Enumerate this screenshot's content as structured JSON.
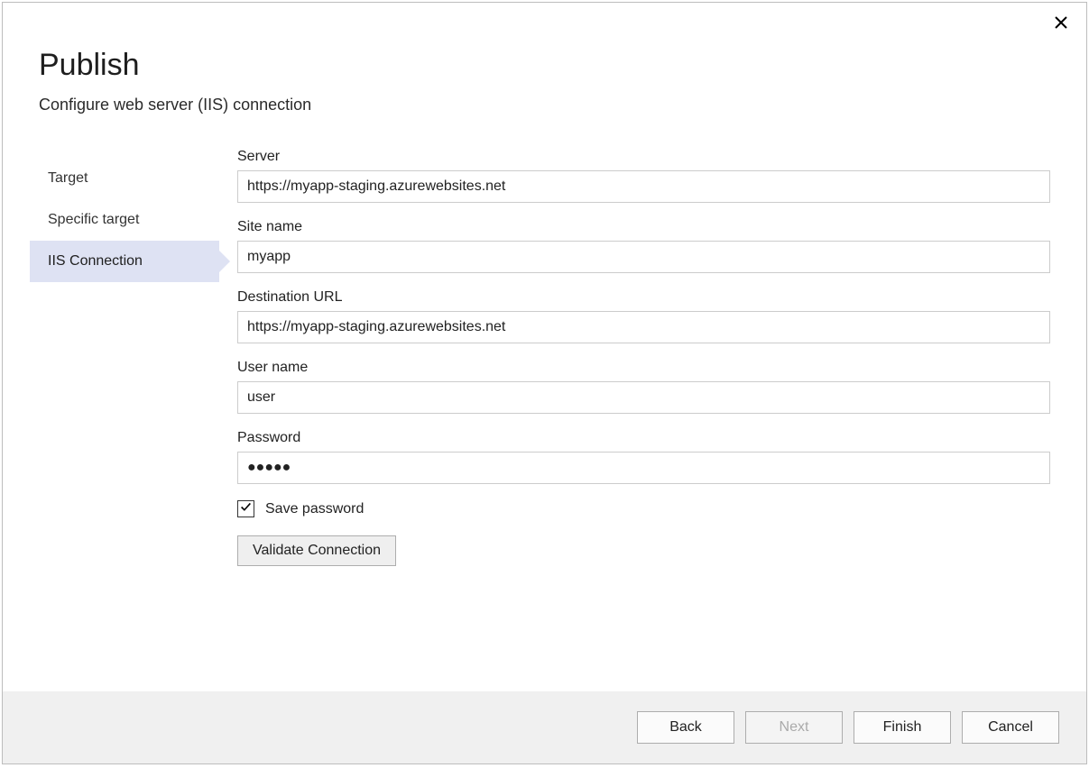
{
  "dialog": {
    "title": "Publish",
    "subtitle": "Configure web server (IIS) connection"
  },
  "sidebar": {
    "items": [
      {
        "label": "Target",
        "active": false
      },
      {
        "label": "Specific target",
        "active": false
      },
      {
        "label": "IIS Connection",
        "active": true
      }
    ]
  },
  "form": {
    "server_label": "Server",
    "server_value": "https://myapp-staging.azurewebsites.net",
    "sitename_label": "Site name",
    "sitename_value": "myapp",
    "desturl_label": "Destination URL",
    "desturl_value": "https://myapp-staging.azurewebsites.net",
    "username_label": "User name",
    "username_value": "user",
    "password_label": "Password",
    "password_value": "●●●●●",
    "savepassword_label": "Save password",
    "savepassword_checked": true,
    "validate_label": "Validate Connection"
  },
  "footer": {
    "back": "Back",
    "next": "Next",
    "finish": "Finish",
    "cancel": "Cancel"
  }
}
